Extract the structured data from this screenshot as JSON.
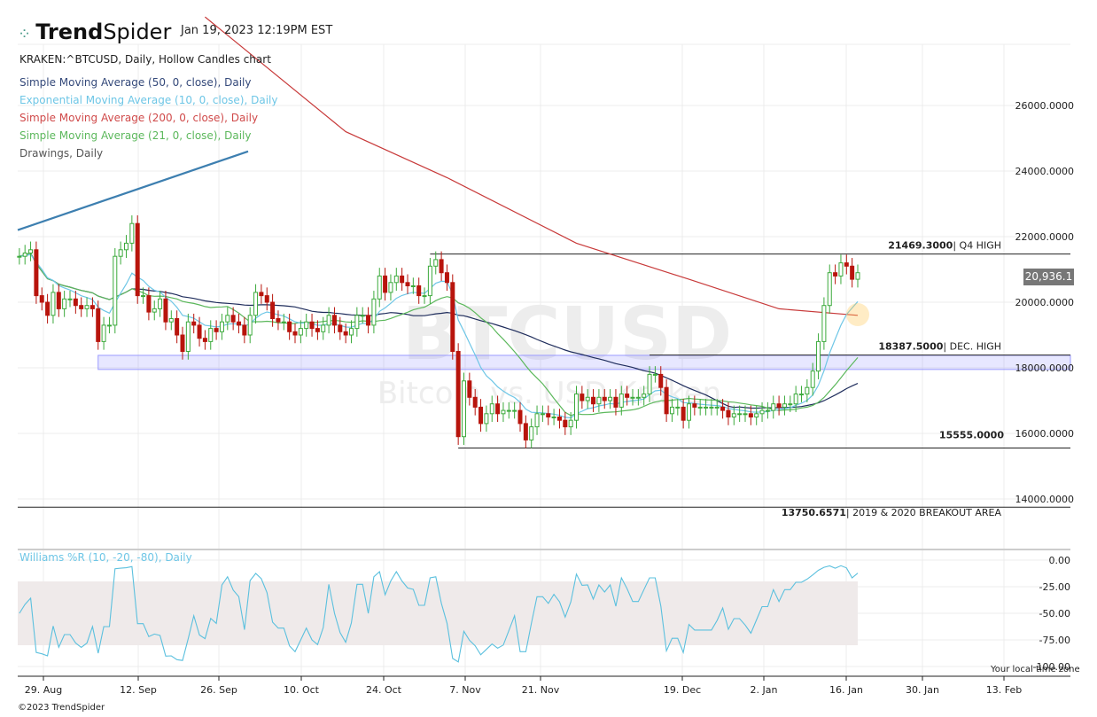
{
  "header": {
    "brand_bold": "Trend",
    "brand_light": "Spider",
    "timestamp": "Jan 19, 2023 12:19PM EST"
  },
  "legend": {
    "symbol": "KRAKEN:^BTCUSD, Daily, Hollow Candles chart",
    "items": [
      {
        "label": "Simple Moving Average (50, 0, close), Daily",
        "color": "#34497a"
      },
      {
        "label": "Exponential Moving Average (10, 0, close), Daily",
        "color": "#6ec6e6"
      },
      {
        "label": "Simple Moving Average (200, 0, close), Daily",
        "color": "#d04a4a"
      },
      {
        "label": "Simple Moving Average (21, 0, close), Daily",
        "color": "#5cb85c"
      },
      {
        "label": "Drawings, Daily",
        "color": "#555555"
      }
    ]
  },
  "watermark": {
    "symbol": "BTCUSD",
    "name": "Bitcoin vs. USD Kraken"
  },
  "price_tag": "20,936.1",
  "indicator_label": "Williams %R (10, -20, -80), Daily",
  "timezone_note": "Your local time zone",
  "footer": "©2023 TrendSpider",
  "chart_data": {
    "type": "candlestick",
    "start_date": "2022-08-23",
    "end_date": "2023-01-19",
    "closes_thousands": [
      21.4,
      21.5,
      21.6,
      20.2,
      20.0,
      19.6,
      20.3,
      19.8,
      20.1,
      20.1,
      19.9,
      19.8,
      19.9,
      19.8,
      18.8,
      19.3,
      19.3,
      21.4,
      21.6,
      21.8,
      22.4,
      20.2,
      20.2,
      19.7,
      19.8,
      20.1,
      19.4,
      19.5,
      19.0,
      18.5,
      19.4,
      19.3,
      18.9,
      18.8,
      19.2,
      19.1,
      19.4,
      19.6,
      19.4,
      19.3,
      19.0,
      19.6,
      20.3,
      20.2,
      20.0,
      19.5,
      19.4,
      19.4,
      19.1,
      19.0,
      19.2,
      19.4,
      19.2,
      19.1,
      19.3,
      19.6,
      19.3,
      19.1,
      19.0,
      19.2,
      19.6,
      19.6,
      19.3,
      20.1,
      20.8,
      20.3,
      20.6,
      20.8,
      20.6,
      20.5,
      20.5,
      20.2,
      20.2,
      21.1,
      21.3,
      20.9,
      20.6,
      18.5,
      15.9,
      17.6,
      17.1,
      16.8,
      16.3,
      16.6,
      16.9,
      16.6,
      16.7,
      16.7,
      16.7,
      16.3,
      15.8,
      16.2,
      16.6,
      16.6,
      16.5,
      16.5,
      16.4,
      16.2,
      16.4,
      17.2,
      17.0,
      17.1,
      16.9,
      17.1,
      17.0,
      17.1,
      16.8,
      17.2,
      17.1,
      17.1,
      17.1,
      17.2,
      17.8,
      17.8,
      17.4,
      16.6,
      16.8,
      16.8,
      16.4,
      16.9,
      16.8,
      16.8,
      16.8,
      16.8,
      16.8,
      16.7,
      16.5,
      16.6,
      16.6,
      16.6,
      16.5,
      16.6,
      16.7,
      16.7,
      16.9,
      16.8,
      16.9,
      16.9,
      17.2,
      17.2,
      17.4,
      17.9,
      18.8,
      19.9,
      20.9,
      20.8,
      21.2,
      21.1,
      20.7,
      20.9
    ],
    "sma200_points": [
      [
        "2022-09-25",
        28.7
      ],
      [
        "2022-10-20",
        25.2
      ],
      [
        "2022-11-07",
        23.8
      ],
      [
        "2022-11-30",
        21.8
      ],
      [
        "2022-12-20",
        20.7
      ],
      [
        "2023-01-05",
        19.8
      ],
      [
        "2023-01-19",
        19.6
      ]
    ],
    "trendline": [
      [
        "2022-08-23",
        22.2
      ],
      [
        "2022-09-30",
        24.6
      ]
    ],
    "levels": [
      {
        "value": "21469.3000",
        "note": "| Q4 HIGH",
        "price": 21469.3,
        "from": "2022-11-04"
      },
      {
        "value": "18387.5000",
        "note": "| DEC. HIGH",
        "price": 18387.5,
        "from": "2022-12-13"
      },
      {
        "value": "15555.0000",
        "note": "",
        "price": 15555,
        "from": "2022-11-09"
      },
      {
        "value": "13750.6571",
        "note": "| 2019 & 2020 BREAKOUT AREA",
        "price": 13750.6571,
        "from": "2022-08-23"
      }
    ],
    "zone": {
      "from": "2022-09-06",
      "low": 17950,
      "high": 18380
    },
    "y_ticks": [
      "26000.0000",
      "24000.0000",
      "22000.0000",
      "20000.0000",
      "18000.0000",
      "16000.0000",
      "14000.0000"
    ],
    "wr_ticks": [
      "0.00",
      "-25.00",
      "-50.00",
      "-75.00",
      "-100.00"
    ],
    "wr_band": [
      -20,
      -80
    ],
    "x_ticks": [
      [
        "29. Aug",
        49
      ],
      [
        "12. Sep",
        156
      ],
      [
        "26. Sep",
        247
      ],
      [
        "10. Oct",
        340
      ],
      [
        "24. Oct",
        433
      ],
      [
        "7. Nov",
        525
      ],
      [
        "21. Nov",
        610
      ],
      [
        "19. Dec",
        770
      ],
      [
        "2. Jan",
        862
      ],
      [
        "16. Jan",
        955
      ],
      [
        "30. Jan",
        1041
      ],
      [
        "13. Feb",
        1133
      ]
    ]
  }
}
